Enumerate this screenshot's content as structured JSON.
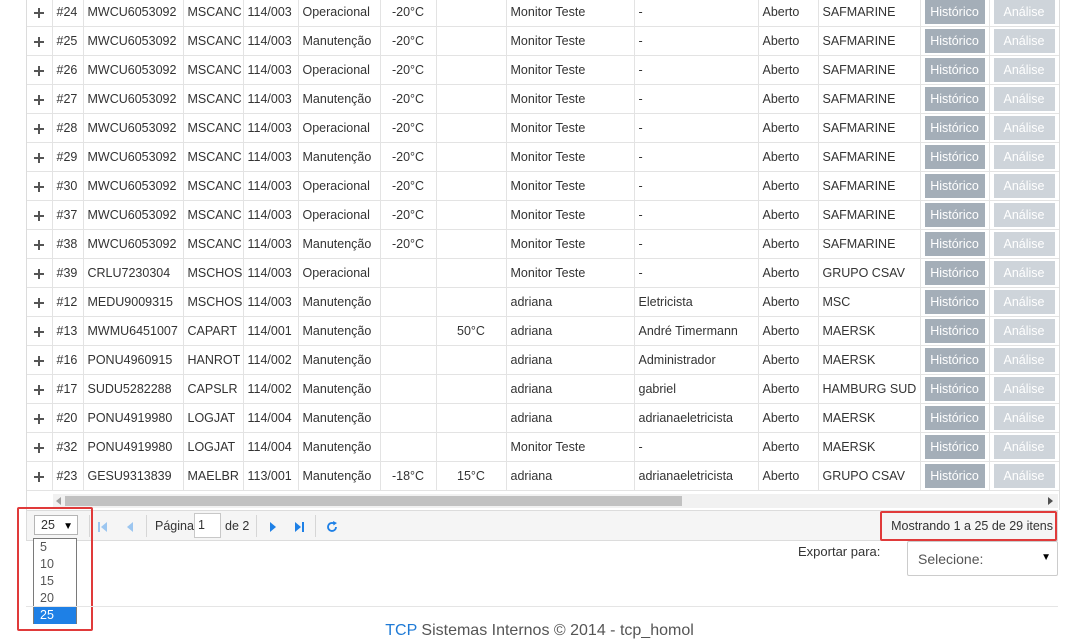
{
  "grid": {
    "rows": [
      {
        "id": "#24",
        "container": "MWCU6053092",
        "code": "MSCANC",
        "slot": "114/003",
        "status": "Operacional",
        "temp": "-20°C",
        "tset": "",
        "monitor": "Monitor Teste",
        "tech": "-",
        "state": "Aberto",
        "carrier": "SAFMARINE"
      },
      {
        "id": "#25",
        "container": "MWCU6053092",
        "code": "MSCANC",
        "slot": "114/003",
        "status": "Manutenção",
        "temp": "-20°C",
        "tset": "",
        "monitor": "Monitor Teste",
        "tech": "-",
        "state": "Aberto",
        "carrier": "SAFMARINE"
      },
      {
        "id": "#26",
        "container": "MWCU6053092",
        "code": "MSCANC",
        "slot": "114/003",
        "status": "Operacional",
        "temp": "-20°C",
        "tset": "",
        "monitor": "Monitor Teste",
        "tech": "-",
        "state": "Aberto",
        "carrier": "SAFMARINE"
      },
      {
        "id": "#27",
        "container": "MWCU6053092",
        "code": "MSCANC",
        "slot": "114/003",
        "status": "Manutenção",
        "temp": "-20°C",
        "tset": "",
        "monitor": "Monitor Teste",
        "tech": "-",
        "state": "Aberto",
        "carrier": "SAFMARINE"
      },
      {
        "id": "#28",
        "container": "MWCU6053092",
        "code": "MSCANC",
        "slot": "114/003",
        "status": "Operacional",
        "temp": "-20°C",
        "tset": "",
        "monitor": "Monitor Teste",
        "tech": "-",
        "state": "Aberto",
        "carrier": "SAFMARINE"
      },
      {
        "id": "#29",
        "container": "MWCU6053092",
        "code": "MSCANC",
        "slot": "114/003",
        "status": "Manutenção",
        "temp": "-20°C",
        "tset": "",
        "monitor": "Monitor Teste",
        "tech": "-",
        "state": "Aberto",
        "carrier": "SAFMARINE"
      },
      {
        "id": "#30",
        "container": "MWCU6053092",
        "code": "MSCANC",
        "slot": "114/003",
        "status": "Operacional",
        "temp": "-20°C",
        "tset": "",
        "monitor": "Monitor Teste",
        "tech": "-",
        "state": "Aberto",
        "carrier": "SAFMARINE"
      },
      {
        "id": "#37",
        "container": "MWCU6053092",
        "code": "MSCANC",
        "slot": "114/003",
        "status": "Operacional",
        "temp": "-20°C",
        "tset": "",
        "monitor": "Monitor Teste",
        "tech": "-",
        "state": "Aberto",
        "carrier": "SAFMARINE"
      },
      {
        "id": "#38",
        "container": "MWCU6053092",
        "code": "MSCANC",
        "slot": "114/003",
        "status": "Manutenção",
        "temp": "-20°C",
        "tset": "",
        "monitor": "Monitor Teste",
        "tech": "-",
        "state": "Aberto",
        "carrier": "SAFMARINE"
      },
      {
        "id": "#39",
        "container": "CRLU7230304",
        "code": "MSCHOS",
        "slot": "114/003",
        "status": "Operacional",
        "temp": "",
        "tset": "",
        "monitor": "Monitor Teste",
        "tech": "-",
        "state": "Aberto",
        "carrier": "GRUPO CSAV"
      },
      {
        "id": "#12",
        "container": "MEDU9009315",
        "code": "MSCHOS",
        "slot": "114/003",
        "status": "Manutenção",
        "temp": "",
        "tset": "",
        "monitor": "adriana",
        "tech": "Eletricista",
        "state": "Aberto",
        "carrier": "MSC"
      },
      {
        "id": "#13",
        "container": "MWMU6451007",
        "code": "CAPART",
        "slot": "114/001",
        "status": "Manutenção",
        "temp": "",
        "tset": "50°C",
        "monitor": "adriana",
        "tech": "André Timermann",
        "state": "Aberto",
        "carrier": "MAERSK"
      },
      {
        "id": "#16",
        "container": "PONU4960915",
        "code": "HANROT",
        "slot": "114/002",
        "status": "Manutenção",
        "temp": "",
        "tset": "",
        "monitor": "adriana",
        "tech": "Administrador",
        "state": "Aberto",
        "carrier": "MAERSK"
      },
      {
        "id": "#17",
        "container": "SUDU5282288",
        "code": "CAPSLR",
        "slot": "114/002",
        "status": "Manutenção",
        "temp": "",
        "tset": "",
        "monitor": "adriana",
        "tech": "gabriel",
        "state": "Aberto",
        "carrier": "HAMBURG SUD"
      },
      {
        "id": "#20",
        "container": "PONU4919980",
        "code": "LOGJAT",
        "slot": "114/004",
        "status": "Manutenção",
        "temp": "",
        "tset": "",
        "monitor": "adriana",
        "tech": "adrianaeletricista",
        "state": "Aberto",
        "carrier": "MAERSK"
      },
      {
        "id": "#32",
        "container": "PONU4919980",
        "code": "LOGJAT",
        "slot": "114/004",
        "status": "Manutenção",
        "temp": "",
        "tset": "",
        "monitor": "Monitor Teste",
        "tech": "-",
        "state": "Aberto",
        "carrier": "MAERSK"
      },
      {
        "id": "#23",
        "container": "GESU9313839",
        "code": "MAELBR",
        "slot": "113/001",
        "status": "Manutenção",
        "temp": "-18°C",
        "tset": "15°C",
        "monitor": "adriana",
        "tech": "adrianaeletricista",
        "state": "Aberto",
        "carrier": "GRUPO CSAV"
      }
    ],
    "historico_label": "Histórico",
    "analise_label": "Análise"
  },
  "pager": {
    "page_size": "25",
    "page_label": "Página",
    "page_value": "1",
    "of_label": "de 2",
    "info": "Mostrando 1 a 25 de 29 itens",
    "size_options": [
      "5",
      "10",
      "15",
      "20",
      "25"
    ]
  },
  "export": {
    "label": "Exportar para:",
    "placeholder": "Selecione:"
  },
  "footer": {
    "brand": "TCP",
    "text": " Sistemas Internos © 2014 - tcp_homol"
  },
  "colors": {
    "historico_btn": "#a4aeb8",
    "analise_btn": "#ced4da",
    "pager_icon": "#1e80e6",
    "highlight_box": "#e03a3a",
    "selected_option": "#1e80e6"
  }
}
